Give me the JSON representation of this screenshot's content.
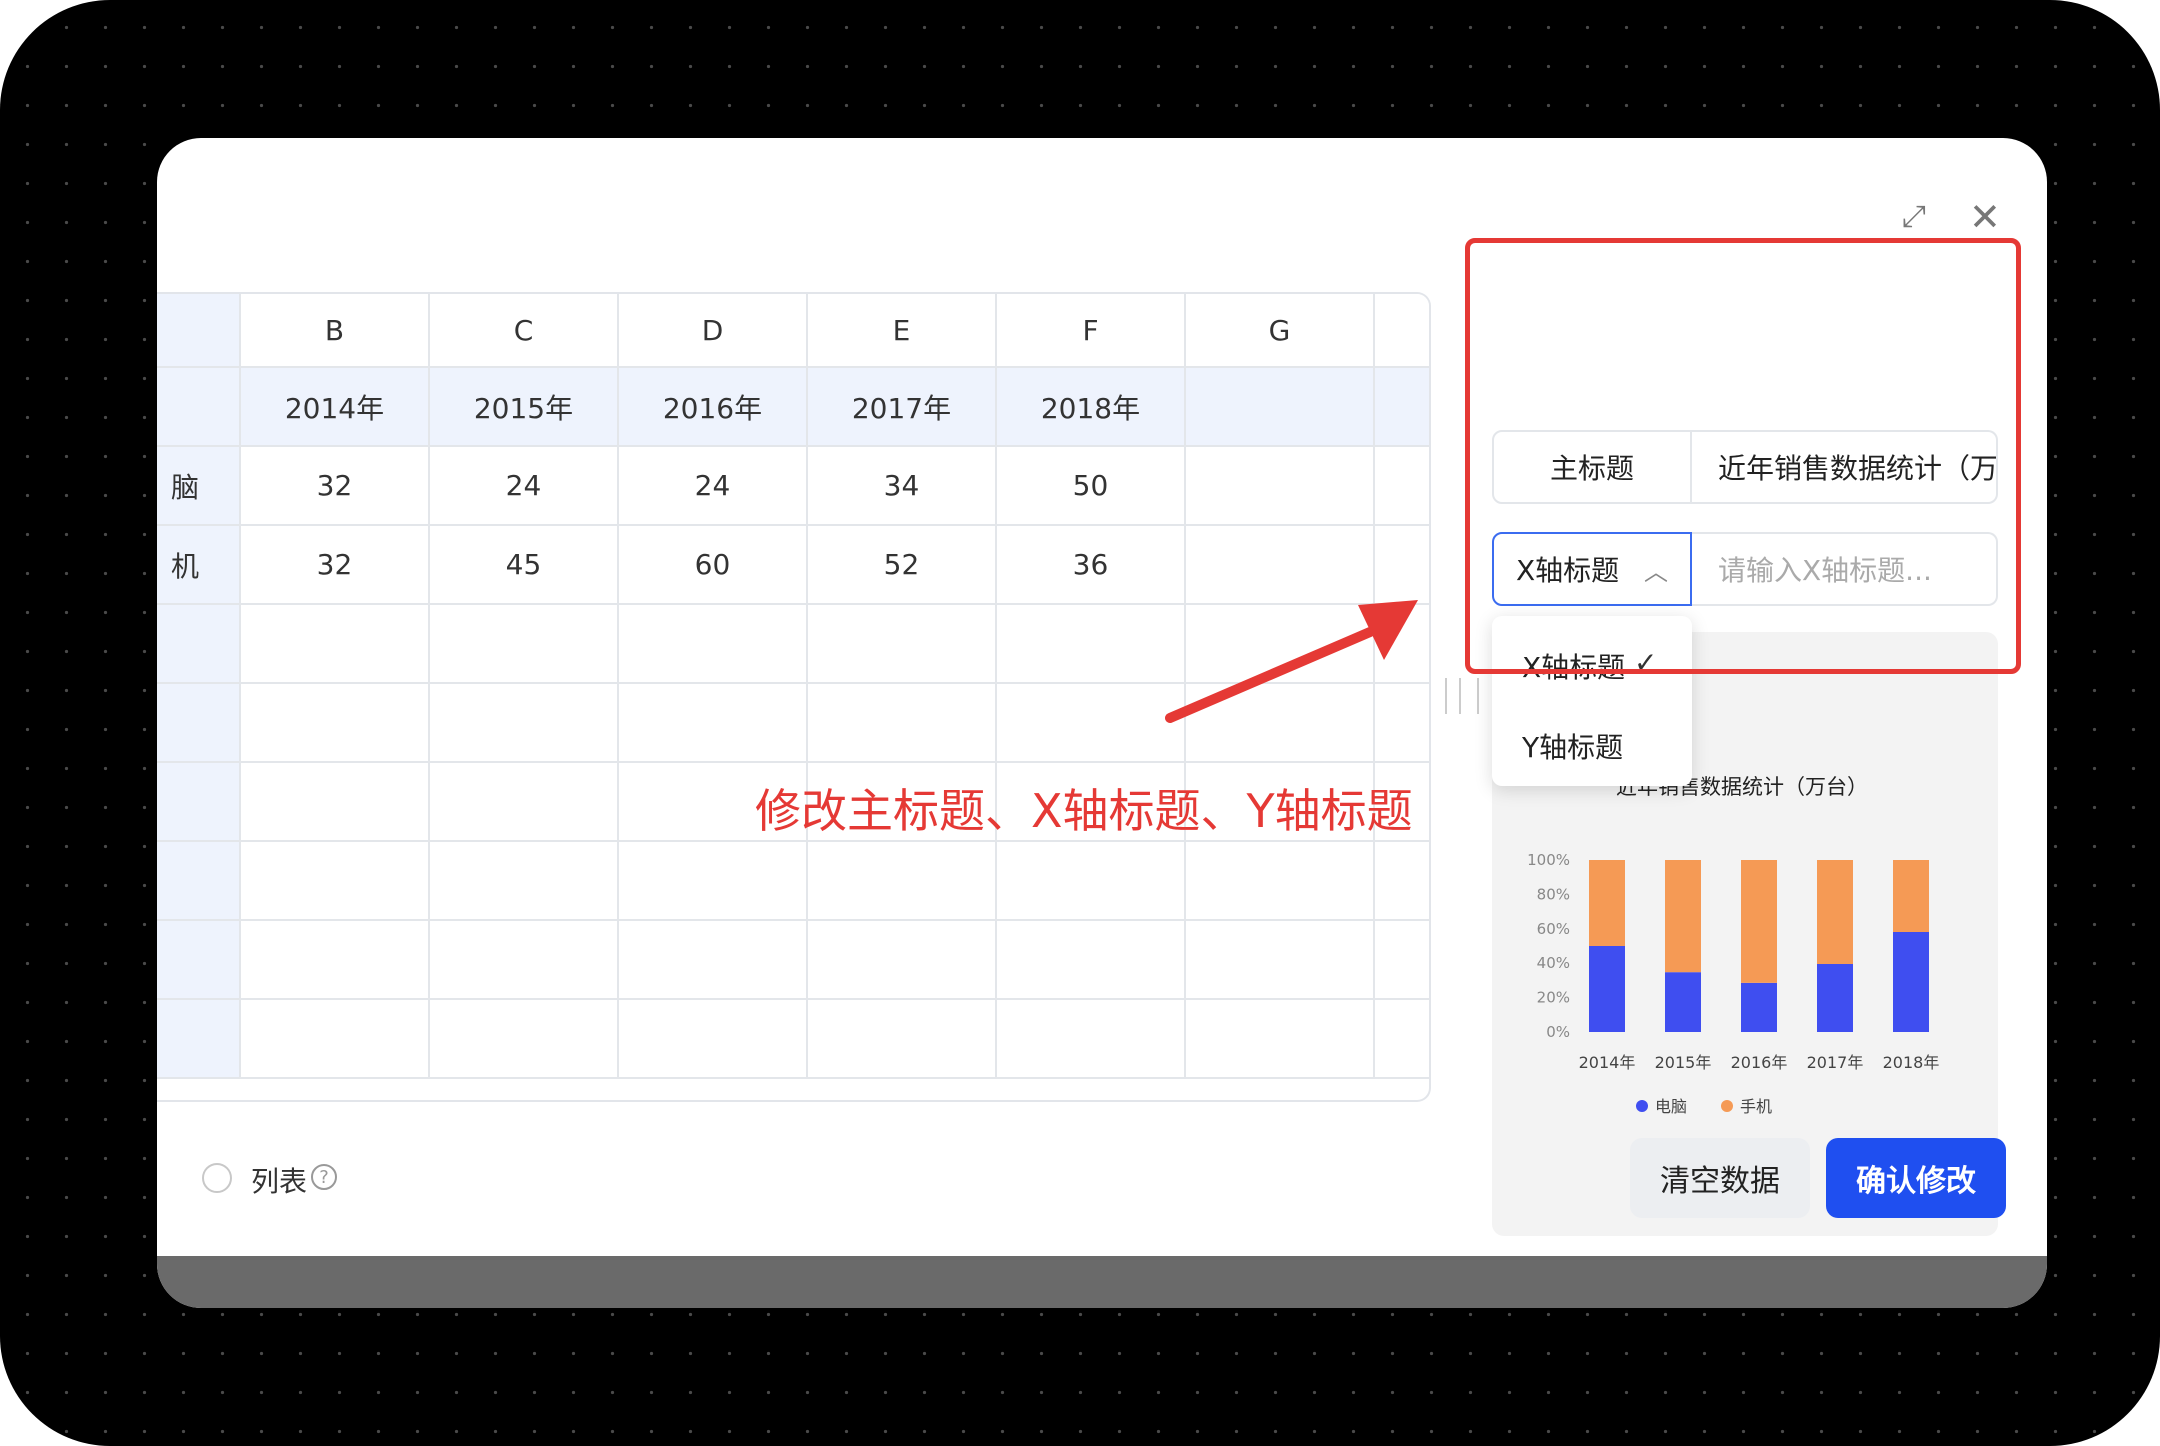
{
  "dialog": {
    "expand_icon": "expand-icon",
    "close_icon": "close-icon"
  },
  "sheet": {
    "columns": [
      "B",
      "C",
      "D",
      "E",
      "F",
      "G"
    ],
    "header_row": [
      "2014年",
      "2015年",
      "2016年",
      "2017年",
      "2018年",
      ""
    ],
    "rows": [
      {
        "label": "脑",
        "values": [
          "32",
          "24",
          "24",
          "34",
          "50",
          ""
        ]
      },
      {
        "label": "机",
        "values": [
          "32",
          "45",
          "60",
          "52",
          "36",
          ""
        ]
      }
    ],
    "empty_rows": 6
  },
  "panel": {
    "main_title_label": "主标题",
    "main_title_value": "近年销售数据统计（万台）",
    "axis_select_value": "X轴标题",
    "axis_input_placeholder": "请输入X轴标题...",
    "dropdown_options": [
      "X轴标题",
      "Y轴标题"
    ],
    "dropdown_selected": "X轴标题"
  },
  "chart_data": {
    "type": "bar",
    "stacked": true,
    "percent": true,
    "title": "近年销售数据统计（万台）",
    "categories": [
      "2014年",
      "2015年",
      "2016年",
      "2017年",
      "2018年"
    ],
    "series": [
      {
        "name": "电脑",
        "values": [
          32,
          24,
          24,
          34,
          50
        ],
        "color": "#3f4ef0"
      },
      {
        "name": "手机",
        "values": [
          32,
          45,
          60,
          52,
          36
        ],
        "color": "#f59a55"
      }
    ],
    "y_ticks": [
      "0%",
      "20%",
      "40%",
      "60%",
      "80%",
      "100%"
    ],
    "ylim": [
      0,
      100
    ],
    "legend_position": "bottom"
  },
  "footer": {
    "list_label": "列表",
    "clear_button": "清空数据",
    "confirm_button": "确认修改"
  },
  "annotation": {
    "text": "修改主标题、X轴标题、Y轴标题",
    "color": "#e53935"
  }
}
